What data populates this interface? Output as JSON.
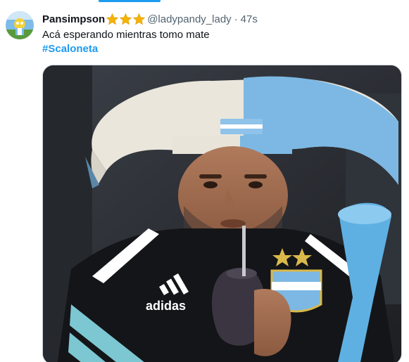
{
  "tweet": {
    "display_name": "Pansimpson",
    "badge_emojis": [
      "star",
      "star",
      "star"
    ],
    "handle": "@ladypandy_lady",
    "separator": "·",
    "time": "47s",
    "text": "Acá esperando mientras tomo mate",
    "hashtag": "#Scaloneta",
    "image_icon": "meme-photo",
    "jersey_brand": "adidas"
  },
  "colors": {
    "link": "#1d9bf0",
    "secondary_text": "#536471",
    "primary_text": "#0f1419",
    "accent_bar": "#1d9bf0",
    "star": "#f4b400",
    "argentina_blue": "#6cb3e3"
  }
}
